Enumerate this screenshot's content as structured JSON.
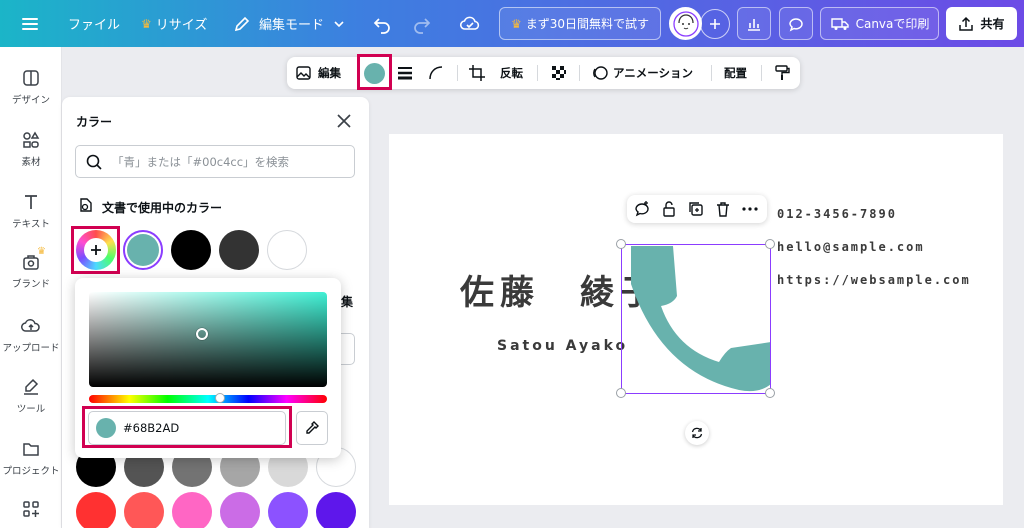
{
  "topbar": {
    "file_label": "ファイル",
    "resize_label": "リサイズ",
    "edit_mode_label": "編集モード",
    "trial_label": "まず30日間無料で試す",
    "print_label": "Canvaで印刷",
    "share_label": "共有"
  },
  "sidebar": {
    "items": [
      {
        "label": "デザイン"
      },
      {
        "label": "素材"
      },
      {
        "label": "テキスト"
      },
      {
        "label": "ブランド"
      },
      {
        "label": "アップロード"
      },
      {
        "label": "ツール"
      },
      {
        "label": "プロジェクト"
      }
    ]
  },
  "context_toolbar": {
    "edit_label": "編集",
    "flip_label": "反転",
    "animation_label": "アニメーション",
    "position_label": "配置"
  },
  "color_panel": {
    "title": "カラー",
    "search_placeholder": "「青」または「#00c4cc」を検索",
    "doc_colors_label": "文書で使用中のカラー",
    "partial_label": "集",
    "doc_colors": [
      "#68B2AD",
      "#000000",
      "#333333",
      "#ffffff"
    ],
    "bottom_colors_row1": [
      "#000000",
      "#545454",
      "#737373",
      "#a6a6a6",
      "#d9d9d9",
      "#ffffff"
    ],
    "bottom_colors_row2": [
      "#ff3131",
      "#ff5757",
      "#ff66c4",
      "#cb6ce6",
      "#8c52ff",
      "#5e17eb"
    ]
  },
  "picker": {
    "hex_value": "#68B2AD",
    "current_color": "#68B2AD"
  },
  "card": {
    "name": "佐藤　綾子",
    "romaji": "Satou Ayako",
    "phone": "012-3456-7890",
    "email": "hello@sample.com",
    "website": "https://websample.com",
    "icon_color": "#68B2AD"
  },
  "colors": {
    "accent": "#8b3dff",
    "highlight": "#d10051"
  }
}
